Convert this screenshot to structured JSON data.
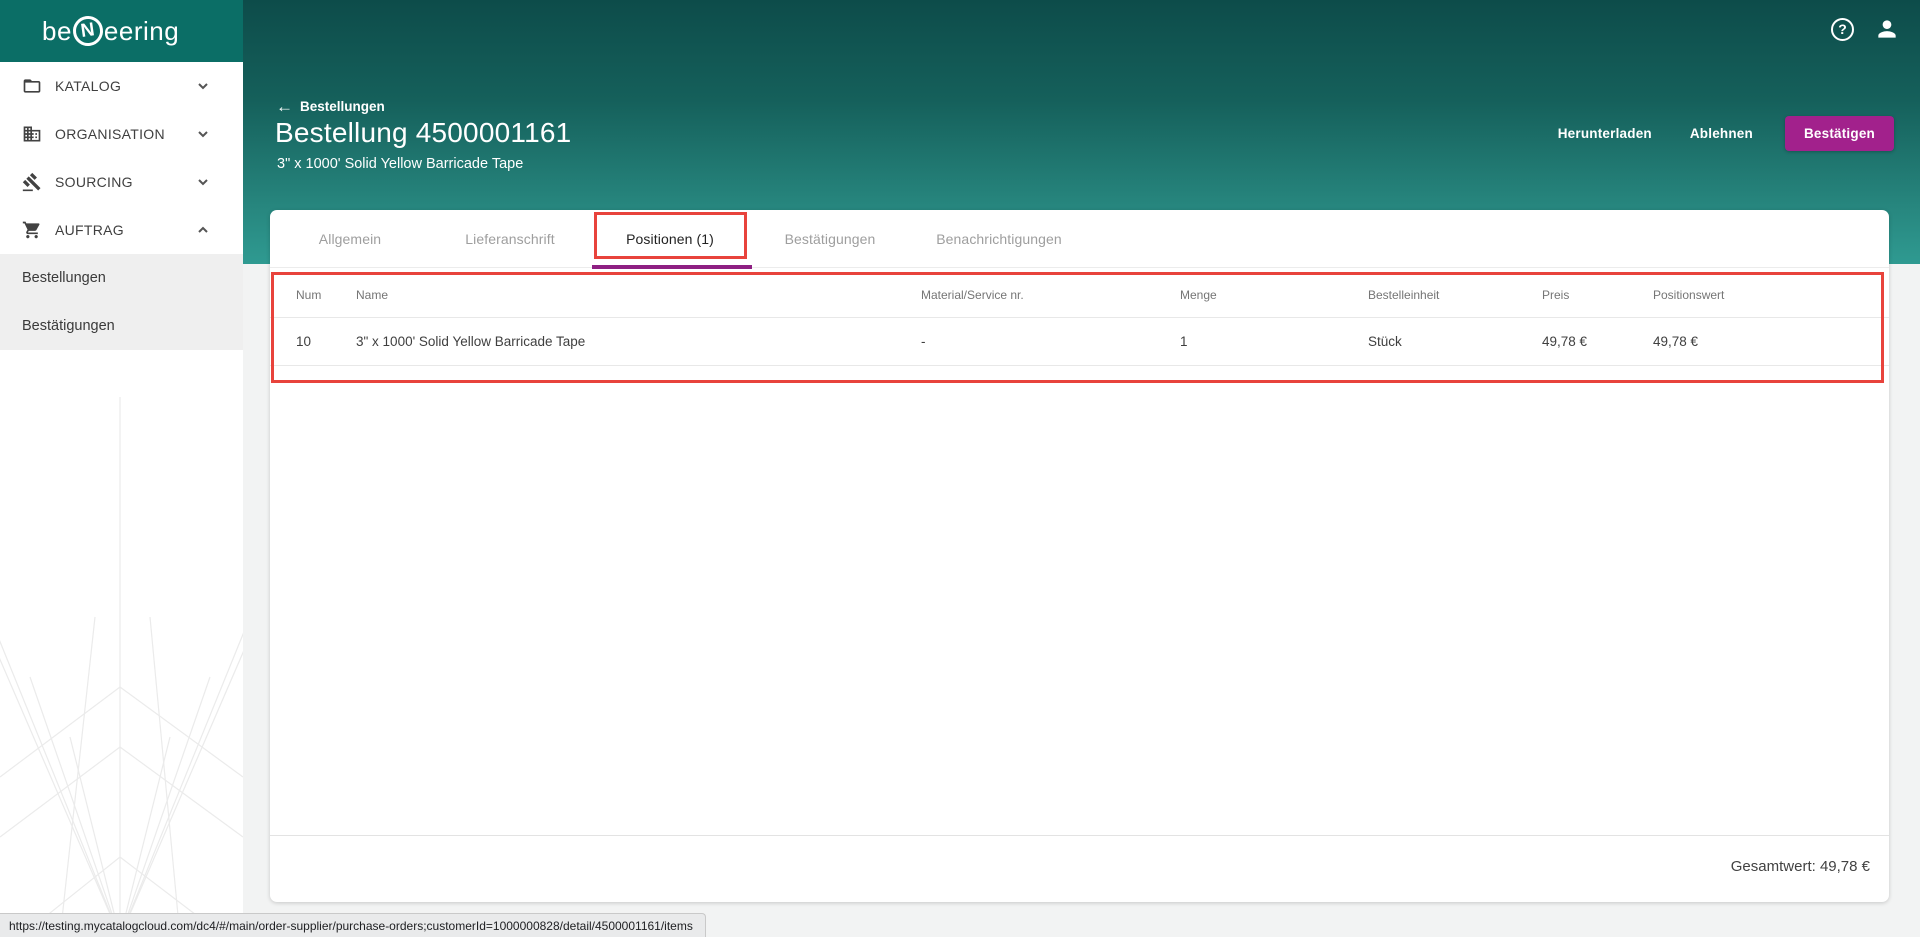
{
  "topbar": {
    "logo": {
      "pre": "be",
      "circle_letter": "N",
      "post": "eering"
    }
  },
  "sidebar": {
    "items": [
      {
        "label": "KATALOG",
        "icon": "folder-icon",
        "chevron": "down"
      },
      {
        "label": "ORGANISATION",
        "icon": "building-icon",
        "chevron": "down"
      },
      {
        "label": "SOURCING",
        "icon": "gavel-icon",
        "chevron": "down"
      },
      {
        "label": "AUFTRAG",
        "icon": "cart-icon",
        "chevron": "up"
      }
    ],
    "submenu": [
      {
        "label": "Bestellungen"
      },
      {
        "label": "Bestätigungen"
      }
    ]
  },
  "header": {
    "back_label": "Bestellungen",
    "back_arrow": "←",
    "title": "Bestellung 4500001161",
    "subtitle": "3\" x 1000' Solid Yellow Barricade Tape",
    "buttons": {
      "download": "Herunterladen",
      "reject": "Ablehnen",
      "confirm": "Bestätigen"
    }
  },
  "tabs": [
    {
      "label": "Allgemein",
      "active": false
    },
    {
      "label": "Lieferanschrift",
      "active": false
    },
    {
      "label": "Positionen (1)",
      "active": true
    },
    {
      "label": "Bestätigungen",
      "active": false
    },
    {
      "label": "Benachrichtigungen",
      "active": false
    }
  ],
  "table": {
    "columns": [
      "Num",
      "Name",
      "Material/Service nr.",
      "Menge",
      "Bestelleinheit",
      "Preis",
      "Positionswert"
    ],
    "rows": [
      [
        "10",
        "3\" x 1000' Solid Yellow Barricade Tape",
        "-",
        "1",
        "Stück",
        "49,78 €",
        "49,78 €"
      ]
    ]
  },
  "footer": {
    "total": "Gesamtwert: 49,78 €"
  },
  "statusbar": {
    "url": "https://testing.mycatalogcloud.com/dc4/#/main/order-supplier/purchase-orders;customerId=1000000828/detail/4500001161/items"
  },
  "help_icon_glyph": "?",
  "colors": {
    "teal_dark": "#0d4c4a",
    "teal_light": "#2f9a91",
    "logo_teal": "#0b6e66",
    "accent_magenta": "#a2218c",
    "ink_bar_purple": "#8e2082",
    "annotation_red": "#e8433c"
  }
}
